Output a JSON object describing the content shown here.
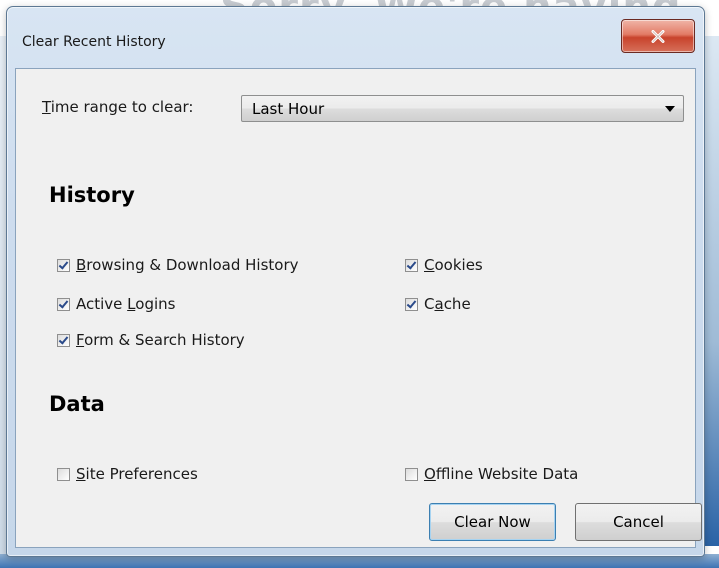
{
  "window": {
    "title": "Clear Recent History",
    "background_text": "Sorry. We're having"
  },
  "time_range": {
    "label_prefix": "",
    "label_mnemonic": "T",
    "label_rest": "ime range to clear:",
    "selected": "Last Hour"
  },
  "history": {
    "heading": "History",
    "items": [
      {
        "mnemonic": "B",
        "rest": "rowsing & Download History",
        "before": "",
        "checked": true
      },
      {
        "mnemonic": "L",
        "rest": "ogins",
        "before": "Active ",
        "checked": true
      },
      {
        "mnemonic": "F",
        "rest": "orm & Search History",
        "before": "",
        "checked": true
      },
      {
        "mnemonic": "C",
        "rest": "ookies",
        "before": "",
        "checked": true
      },
      {
        "mnemonic": "a",
        "rest": "che",
        "before": "C",
        "checked": true
      }
    ]
  },
  "data": {
    "heading": "Data",
    "items": [
      {
        "mnemonic": "S",
        "rest": "ite Preferences",
        "before": "",
        "checked": false
      },
      {
        "mnemonic": "O",
        "rest": "ffline Website Data",
        "before": "",
        "checked": false
      }
    ]
  },
  "buttons": {
    "clear_now": "Clear Now",
    "cancel": "Cancel"
  },
  "icons": {
    "close": "close-icon"
  }
}
